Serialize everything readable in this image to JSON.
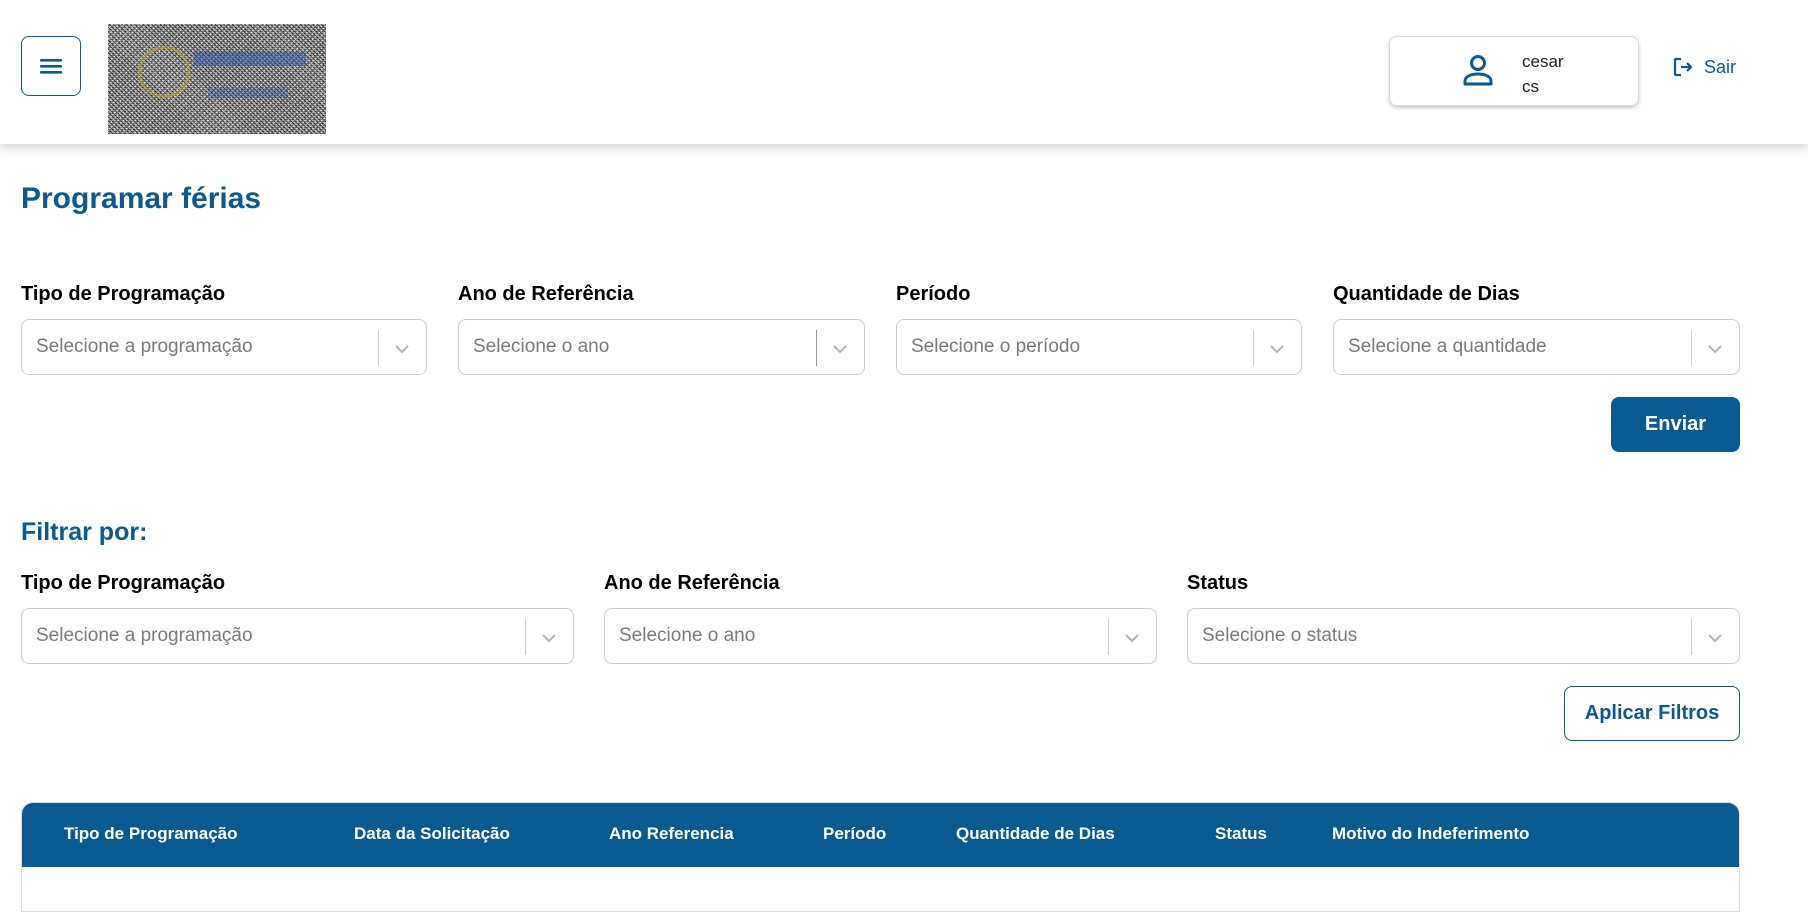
{
  "header": {
    "menu_icon": "hamburger-menu-icon",
    "user": {
      "icon": "person-icon",
      "name_line1": "cesar",
      "name_line2": "cs"
    },
    "logout_label": "Sair",
    "logout_icon": "logout-icon"
  },
  "page": {
    "title": "Programar férias"
  },
  "schedule_form": {
    "fields": [
      {
        "label": "Tipo de Programação",
        "placeholder": "Selecione a programação"
      },
      {
        "label": "Ano de Referência",
        "placeholder": "Selecione o ano"
      },
      {
        "label": "Período",
        "placeholder": "Selecione o período"
      },
      {
        "label": "Quantidade de Dias",
        "placeholder": "Selecione a quantidade"
      }
    ],
    "submit_label": "Enviar"
  },
  "filters": {
    "title": "Filtrar por:",
    "fields": [
      {
        "label": "Tipo de Programação",
        "placeholder": "Selecione a programação"
      },
      {
        "label": "Ano de Referência",
        "placeholder": "Selecione o ano"
      },
      {
        "label": "Status",
        "placeholder": "Selecione o status"
      }
    ],
    "apply_label": "Aplicar Filtros"
  },
  "table": {
    "columns": [
      "Tipo de Programação",
      "Data da Solicitação",
      "Ano Referencia",
      "Período",
      "Quantidade de Dias",
      "Status",
      "Motivo do Indeferimento"
    ]
  },
  "colors": {
    "primary": "#0b5a8f",
    "border": "#cccccc",
    "placeholder": "#7a7a7a"
  }
}
